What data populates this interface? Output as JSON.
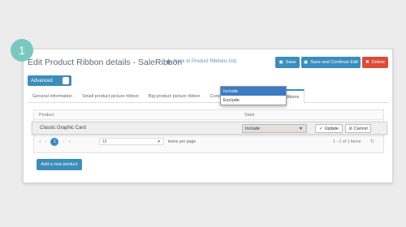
{
  "step_number": "1",
  "header": {
    "title": "Edit Product Ribbon details - SaleRibbon",
    "back_link": "(back to Product Ribbons list)",
    "save_label": "Save",
    "save_continue_label": "Save and Continue Edit",
    "delete_label": "Delete"
  },
  "advanced_label": "Advanced",
  "tabs": [
    {
      "label": "General information"
    },
    {
      "label": "Small product picture ribbon"
    },
    {
      "label": "Big product picture ribbon"
    },
    {
      "label": "Conditions"
    },
    {
      "label": "Override Product Conditions"
    }
  ],
  "grid": {
    "headers": {
      "product": "Product",
      "state": "State"
    },
    "edit_row": {
      "product": "Classic Graphic Card",
      "state_value": "Include",
      "update_label": "Update",
      "cancel_label": "Cancel"
    },
    "state_options": [
      "Include",
      "Exclude"
    ],
    "pager": {
      "first": "«",
      "prev": "‹",
      "current_page": "1",
      "next": "›",
      "last": "»",
      "page_size": "15",
      "items_per_page_label": "items per page",
      "items_count": "1 - 1 of 1 items"
    }
  },
  "add_button_label": "Add a new product",
  "colors": {
    "primary": "#3c8dbc",
    "danger": "#dd4b39",
    "badge": "#7bc8c0",
    "selected_option": "#3d7ac4"
  }
}
